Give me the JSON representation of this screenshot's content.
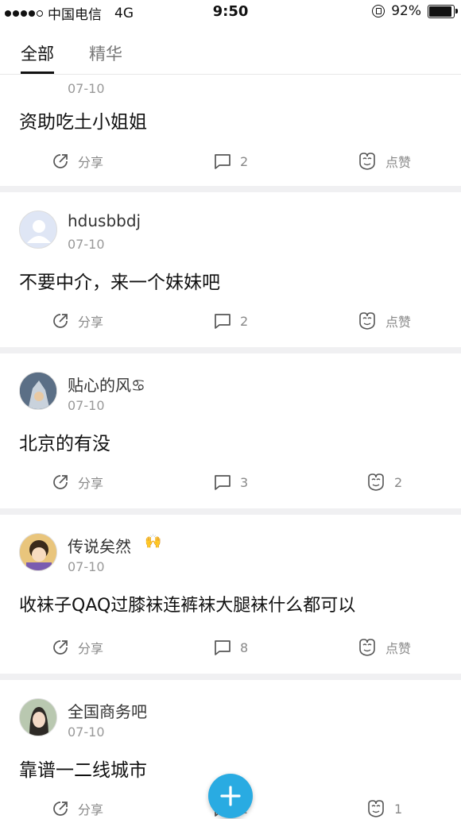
{
  "status_bar": {
    "carrier": "中国电信",
    "network": "4G",
    "time": "9:50",
    "battery": "92%",
    "battery_level": 0.92
  },
  "tabs": [
    {
      "label": "全部",
      "active": true
    },
    {
      "label": "精华",
      "active": false
    }
  ],
  "posts": [
    {
      "username": "",
      "date": "07-10",
      "content": "资助吃土小姐姐",
      "share_label": "分享",
      "comment_count": "2",
      "like_label": "点赞"
    },
    {
      "username": "hdusbbdj",
      "date": "07-10",
      "content": "不要中介，来一个妹妹吧",
      "share_label": "分享",
      "comment_count": "2",
      "like_label": "点赞"
    },
    {
      "username": "贴心的风♋",
      "date": "07-10",
      "content": "北京的有没",
      "share_label": "分享",
      "comment_count": "3",
      "like_label": "2"
    },
    {
      "username": "传说矣然",
      "date": "07-10",
      "content": "收袜子QAQ过膝袜连裤袜大腿袜什么都可以",
      "share_label": "分享",
      "comment_count": "8",
      "like_label": "点赞"
    },
    {
      "username": "全国商务吧",
      "date": "07-10",
      "content": "靠谱一二线城市",
      "share_label": "分享",
      "comment_count": "2",
      "like_label": "1"
    }
  ],
  "colors": {
    "accent": "#29abe2",
    "divider": "#f0f0f2",
    "text_muted": "#999999"
  }
}
